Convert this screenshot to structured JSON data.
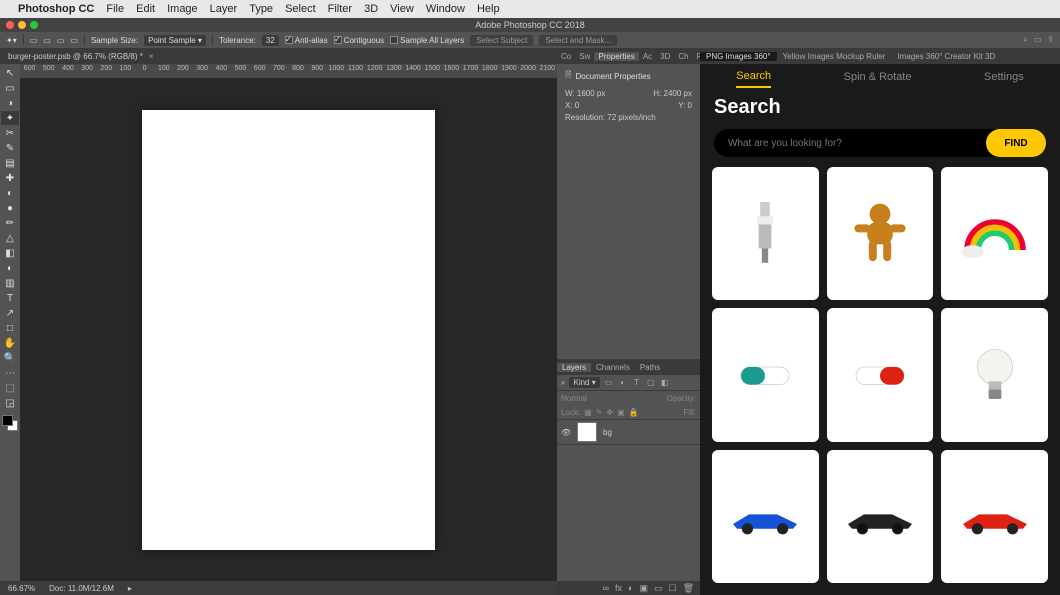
{
  "menubar": [
    "Photoshop CC",
    "File",
    "Edit",
    "Image",
    "Layer",
    "Type",
    "Select",
    "Filter",
    "3D",
    "View",
    "Window",
    "Help"
  ],
  "titlebar": {
    "title": "Adobe Photoshop CC 2018"
  },
  "optbar": {
    "sampleSize_label": "Sample Size:",
    "sampleSize_value": "Point Sample",
    "tolerance_label": "Tolerance:",
    "tolerance_value": "32",
    "antiAlias_label": "Anti-alias",
    "contiguous_label": "Contiguous",
    "sampleAll_label": "Sample All Layers",
    "selectSubject": "Select Subject",
    "selectMask": "Select and Mask..."
  },
  "doc": {
    "tab": "burger-poster.psb @ 66.7% (RGB/8) *"
  },
  "ruler": [
    "600",
    "500",
    "400",
    "300",
    "200",
    "100",
    "0",
    "100",
    "200",
    "300",
    "400",
    "500",
    "600",
    "700",
    "800",
    "900",
    "1000",
    "1100",
    "1200",
    "1300",
    "1400",
    "1500",
    "1600",
    "1700",
    "1800",
    "1900",
    "2000",
    "2100"
  ],
  "tools": [
    "↖",
    "▭",
    "◑",
    "✦",
    "✂",
    "✎",
    "▤",
    "✚",
    "◐",
    "●",
    "✏",
    "△",
    "◧",
    "◐",
    "▥",
    "T",
    "↗",
    "□",
    "✋",
    "🔍",
    "⋯",
    "⬚",
    "◲"
  ],
  "foregroundColor": "#000000",
  "properties": {
    "tabs": [
      "Co",
      "Sw",
      "Properties",
      "Ac",
      "3D",
      "Ch",
      "Par"
    ],
    "header": "Document Properties",
    "w_label": "W:",
    "w_value": "1600 px",
    "h_label": "H:",
    "h_value": "2400 px",
    "x_label": "X:",
    "x_value": "0",
    "y_label": "Y:",
    "y_value": "0",
    "res_label": "Resolution:",
    "res_value": "72 pixels/inch"
  },
  "layers": {
    "tabs": [
      "Layers",
      "Channels",
      "Paths"
    ],
    "filterIcons": [
      "▭",
      "◐",
      "T",
      "▢",
      "◧"
    ],
    "kind": "Kind",
    "blend_label": "Normal",
    "opacity_label": "Opacity:",
    "lock_label": "Lock:",
    "fill_label": "Fill:",
    "items": [
      {
        "name": "bg"
      }
    ],
    "footerIcons": [
      "∞",
      "fx",
      "◐",
      "▣",
      "▭",
      "☐",
      "🗑"
    ]
  },
  "plugin": {
    "tabs": [
      "PNG Images 360°",
      "Yellow Images Mockup Ruler",
      "Images 360° Creator Kit 3D"
    ],
    "subnav": [
      "Search",
      "Spin & Rotate",
      "Settings"
    ],
    "heading": "Search",
    "placeholder": "What are you looking for?",
    "findLabel": "FIND",
    "items": [
      {
        "name": "spark-plug"
      },
      {
        "name": "gingerbread-man"
      },
      {
        "name": "rainbow"
      },
      {
        "name": "capsule-teal"
      },
      {
        "name": "capsule-red"
      },
      {
        "name": "light-bulb"
      },
      {
        "name": "race-car-blue"
      },
      {
        "name": "race-car-black"
      },
      {
        "name": "race-car-red"
      }
    ]
  },
  "status": {
    "zoom": "66.67%",
    "doc": "Doc: 11.0M/12.6M"
  }
}
